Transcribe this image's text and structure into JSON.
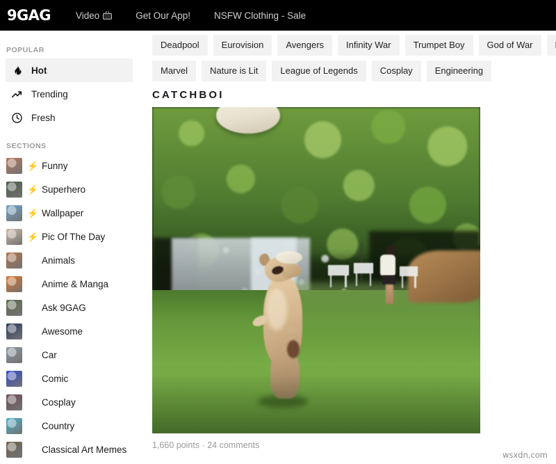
{
  "header": {
    "logo": "9GAG",
    "nav": [
      {
        "label": "Video",
        "icon": "tv-icon"
      },
      {
        "label": "Get Our App!",
        "icon": null
      },
      {
        "label": "NSFW Clothing - Sale",
        "icon": null
      }
    ]
  },
  "sidebar": {
    "popular_heading": "POPULAR",
    "popular": [
      {
        "label": "Hot",
        "icon": "flame-icon",
        "active": true
      },
      {
        "label": "Trending",
        "icon": "trending-arrow-icon",
        "active": false
      },
      {
        "label": "Fresh",
        "icon": "clock-icon",
        "active": false
      }
    ],
    "sections_heading": "SECTIONS",
    "sections": [
      {
        "label": "Funny",
        "hot": true,
        "thumb": "#b4755a"
      },
      {
        "label": "Superhero",
        "hot": true,
        "thumb": "#4a5a48"
      },
      {
        "label": "Wallpaper",
        "hot": true,
        "thumb": "#6fa3c8"
      },
      {
        "label": "Pic Of The Day",
        "hot": true,
        "thumb": "#cbb9a6"
      },
      {
        "label": "Animals",
        "hot": false,
        "thumb": "#b3724a"
      },
      {
        "label": "Anime & Manga",
        "hot": false,
        "thumb": "#d8742c"
      },
      {
        "label": "Ask 9GAG",
        "hot": false,
        "thumb": "#5d6b4c"
      },
      {
        "label": "Awesome",
        "hot": false,
        "thumb": "#2b3a5c"
      },
      {
        "label": "Car",
        "hot": false,
        "thumb": "#8a97a3"
      },
      {
        "label": "Comic",
        "hot": false,
        "thumb": "#2f49c4"
      },
      {
        "label": "Cosplay",
        "hot": false,
        "thumb": "#6b4a52"
      },
      {
        "label": "Country",
        "hot": false,
        "thumb": "#4fb0c9"
      },
      {
        "label": "Classical Art Memes",
        "hot": false,
        "thumb": "#6d6050"
      }
    ]
  },
  "main": {
    "tag_rows": [
      [
        "Deadpool",
        "Eurovision",
        "Avengers",
        "Infinity War",
        "Trumpet Boy",
        "God of War",
        "Fortnite"
      ],
      [
        "Marvel",
        "Nature is Lit",
        "League of Legends",
        "Cosplay",
        "Engineering"
      ]
    ],
    "post": {
      "title": "CATCHBOI",
      "points": "1,660 points",
      "separator": "·",
      "comments": "24 comments",
      "meta": "1,660 points · 24 comments",
      "media_alt": "dog jumping to catch a frisbee on a lawn"
    }
  },
  "watermark": "wsxdn.com",
  "colors": {
    "header_bg": "#000000",
    "chip_bg": "#f2f2f2",
    "active_row_bg": "#f2f2f2",
    "heading_text": "#9b9b9b",
    "body_text": "#1a1a1a",
    "meta_text": "#9a9a9a",
    "bolt": "#f2c200"
  }
}
